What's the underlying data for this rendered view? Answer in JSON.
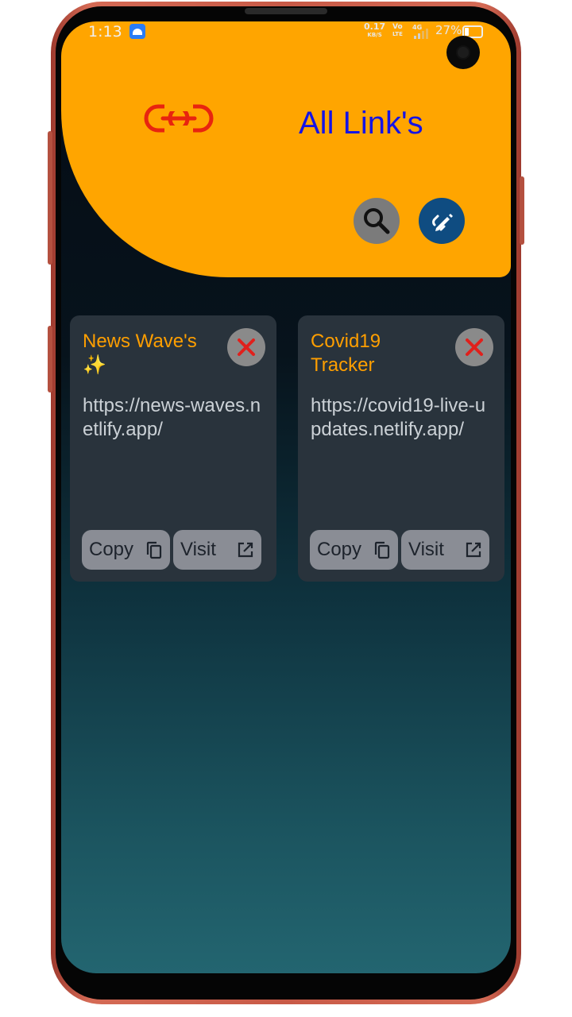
{
  "status_bar": {
    "time": "1:13",
    "net_speed": "0.17",
    "net_unit": "KB/S",
    "volte_top": "Vo",
    "volte_bottom": "LTE",
    "signal_type": "4G",
    "battery": "27%"
  },
  "header": {
    "title": "All Link's",
    "logo_icon": "link-icon",
    "search_icon": "search-icon",
    "edit_icon": "edit-link-icon",
    "colors": {
      "background": "#ffa500",
      "title": "#1414e6",
      "logo": "#e8240f"
    }
  },
  "links": [
    {
      "title": "News Wave's",
      "emoji": "✨",
      "url": "https://news-waves.netlify.app/",
      "copy_label": "Copy",
      "visit_label": "Visit"
    },
    {
      "title": "Covid19 Tracker",
      "emoji": "",
      "url": "https://covid19-live-updates.netlify.app/",
      "copy_label": "Copy",
      "visit_label": "Visit"
    }
  ]
}
